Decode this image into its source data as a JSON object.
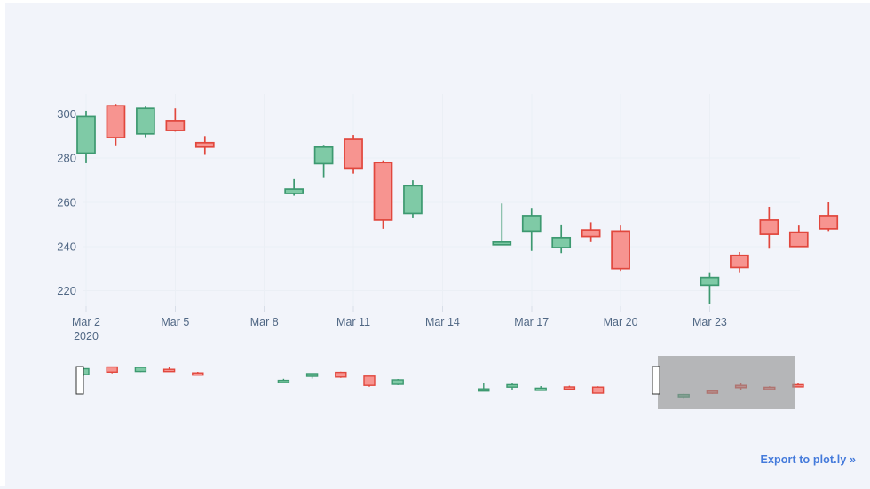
{
  "footer": {
    "export_label": "Export to plot.ly »",
    "export_color": "#447adb"
  },
  "colors": {
    "background": "#f2f4fa",
    "plot_background": "#f2f4fa",
    "gridline": "#ebeff5",
    "tick_text": "#506784",
    "increasing_fill": "#7fcaa6",
    "increasing_line": "#3d9970",
    "decreasing_fill": "#f79490",
    "decreasing_line": "#e1473d",
    "rangeslider_mask": "#8f8f8f",
    "rangeslider_handle": "#ffffff",
    "rangeslider_handle_border": "#333333"
  },
  "chart_data": {
    "type": "candlestick",
    "title": "",
    "xlabel": "",
    "ylabel": "",
    "ylim": [
      213,
      307
    ],
    "yticks": [
      220,
      240,
      260,
      280,
      300
    ],
    "xtick_labels": [
      "Mar 2",
      "Mar 5",
      "Mar 8",
      "Mar 11",
      "Mar 14",
      "Mar 17",
      "Mar 20",
      "Mar 23"
    ],
    "xtick_sublabel": "2020",
    "xtick_sublabel_index": 0,
    "grid": true,
    "legend": "none",
    "rangeslider": {
      "visible": true,
      "selection_start_label": "Mar 22",
      "selection_end_label": "Mar 27"
    },
    "x": [
      "Mar 2",
      "Mar 3",
      "Mar 4",
      "Mar 5",
      "Mar 6",
      "Mar 9",
      "Mar 10",
      "Mar 11",
      "Mar 12",
      "Mar 13",
      "Mar 16",
      "Mar 17",
      "Mar 18",
      "Mar 19",
      "Mar 20",
      "Mar 23",
      "Mar 24",
      "Mar 25",
      "Mar 26",
      "Mar 27"
    ],
    "open": [
      282.3,
      303.7,
      291.0,
      297.0,
      287.0,
      264.0,
      277.5,
      288.5,
      278.0,
      255.0,
      241.5,
      247.0,
      239.5,
      247.5,
      247.0,
      222.5,
      236.0,
      252.0,
      246.5,
      254.0
    ],
    "high": [
      301.4,
      304.5,
      303.3,
      302.5,
      290.0,
      270.5,
      286.0,
      290.5,
      279.0,
      270.0,
      259.5,
      257.5,
      250.0,
      251.0,
      249.5,
      228.0,
      237.5,
      258.0,
      249.5,
      260.0
    ],
    "low": [
      277.7,
      285.8,
      289.5,
      292.0,
      281.5,
      263.0,
      271.0,
      273.0,
      248.0,
      252.8,
      241.0,
      238.0,
      237.0,
      242.0,
      229.0,
      214.0,
      228.0,
      239.0,
      242.0,
      247.0
    ],
    "close": [
      298.8,
      289.3,
      302.5,
      292.5,
      285.0,
      266.0,
      285.0,
      275.5,
      252.0,
      267.5,
      242.0,
      254.0,
      244.0,
      244.5,
      230.0,
      226.0,
      230.5,
      245.5,
      240.0,
      248.0
    ],
    "direction": [
      "up",
      "down",
      "up",
      "down",
      "down",
      "up",
      "up",
      "down",
      "down",
      "up",
      "up",
      "up",
      "up",
      "down",
      "down",
      "up",
      "down",
      "down",
      "down",
      "down"
    ]
  },
  "rangeslider_series": {
    "ylim": [
      205,
      315
    ],
    "x": [
      "Mar 2",
      "Mar 3",
      "Mar 4",
      "Mar 5",
      "Mar 6",
      "Mar 9",
      "Mar 10",
      "Mar 11",
      "Mar 12",
      "Mar 13",
      "Mar 16",
      "Mar 17",
      "Mar 18",
      "Mar 19",
      "Mar 20",
      "Mar 23",
      "Mar 24",
      "Mar 25",
      "Mar 26",
      "Mar 27"
    ]
  }
}
